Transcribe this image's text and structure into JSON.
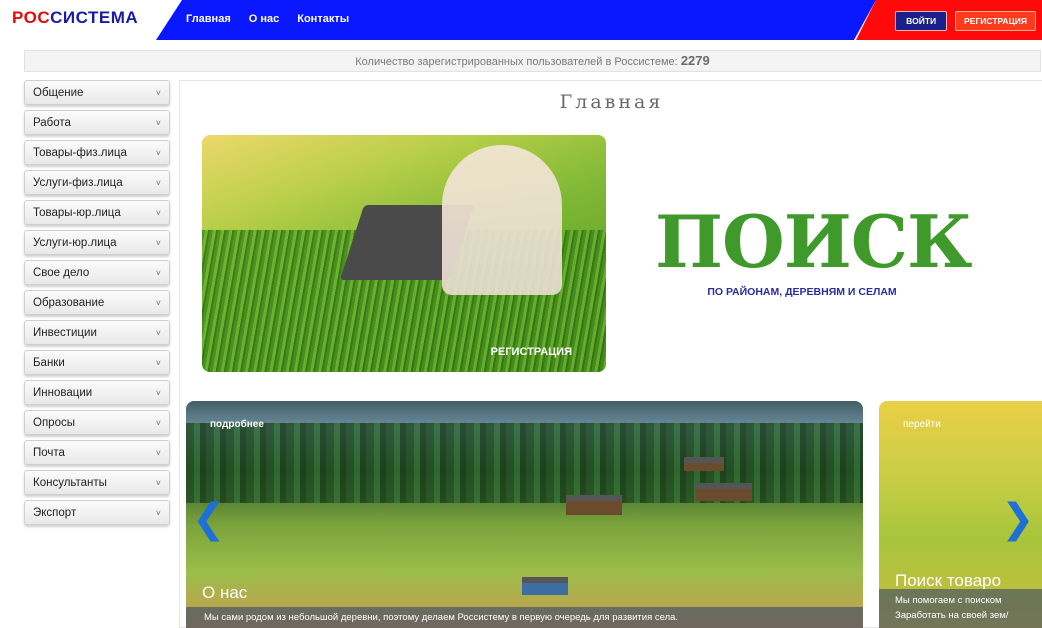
{
  "header": {
    "logo_part1": "РОС",
    "logo_part2": "СИСТЕМА",
    "nav": [
      "Главная",
      "О нас",
      "Контакты"
    ],
    "login_label": "ВОЙТИ",
    "register_label": "РЕГИСТРАЦИЯ"
  },
  "counter": {
    "text": "Количество зарегистрированных пользователей в Россистеме:",
    "value": "2279"
  },
  "sidebar": {
    "items": [
      "Общение",
      "Работа",
      "Товары-физ.лица",
      "Услуги-физ.лица",
      "Товары-юр.лица",
      "Услуги-юр.лица",
      "Свое дело",
      "Образование",
      "Инвестиции",
      "Банки",
      "Инновации",
      "Опросы",
      "Почта",
      "Консультанты",
      "Экспорт"
    ],
    "chevron_glyph": "˅"
  },
  "main": {
    "title": "Главная",
    "hero_cta": "РЕГИСТРАЦИЯ",
    "search_title": "ПОИСК",
    "search_subtitle": "ПО РАЙОНАМ, ДЕРЕВНЯМ И СЕЛАМ",
    "slide_main": {
      "link": "подробнее",
      "title": "О нас",
      "caption": "Мы сами родом из небольшой деревни, поэтому делаем Россистему в первую очередь для развития села."
    },
    "slide_side": {
      "link": "перейти",
      "title": "Поиск товаро",
      "caption_line1": "Мы помогаем с поиском",
      "caption_line2": "Заработать на своей зем/"
    },
    "arrow_left": "❮",
    "arrow_right": "❯"
  },
  "colors": {
    "nav_blue": "#0a18ff",
    "header_red": "#ff0a0a",
    "logo_red": "#e30b0b",
    "logo_blue": "#1a1aa8",
    "search_green": "#3f9a2b"
  }
}
